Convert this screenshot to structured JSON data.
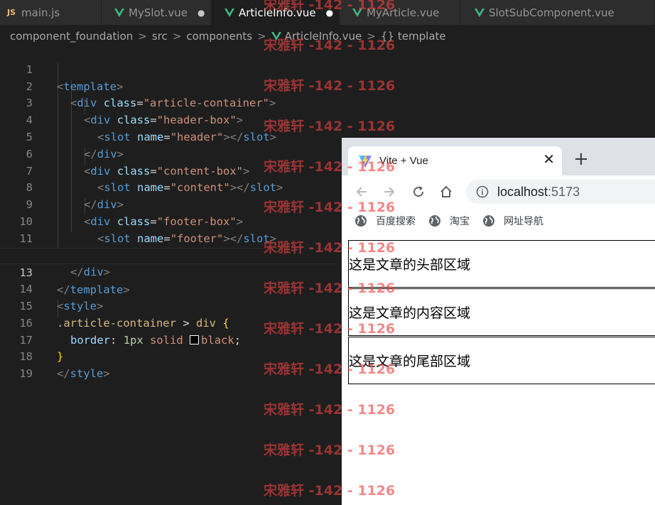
{
  "editor": {
    "tabs": [
      {
        "label": "main.js",
        "icon": "js-file-icon",
        "modified": false,
        "active": false
      },
      {
        "label": "MySlot.vue",
        "icon": "vue-file-icon",
        "modified": true,
        "active": false
      },
      {
        "label": "ArticleInfo.vue",
        "icon": "vue-file-icon",
        "modified": true,
        "active": true
      },
      {
        "label": "MyArticle.vue",
        "icon": "vue-file-icon",
        "modified": false,
        "active": false
      },
      {
        "label": "SlotSubComponent.vue",
        "icon": "vue-file-icon",
        "modified": false,
        "active": false
      }
    ],
    "js_icon_text": "JS",
    "modified_dot": "●",
    "breadcrumb": {
      "items": [
        "component_foundation",
        "src",
        "components",
        "ArticleInfo.vue",
        "template"
      ],
      "separator": ">",
      "symbol_icon": "{}"
    },
    "line_numbers": [
      "1",
      "2",
      "3",
      "4",
      "5",
      "6",
      "7",
      "8",
      "9",
      "10",
      "11",
      "12",
      "13",
      "14",
      "15",
      "16",
      "17",
      "18",
      "19"
    ],
    "current_line": "13",
    "code": {
      "l1": "template",
      "l2_tag": "div",
      "l2_attr": "class",
      "l2_val": "\"article-container\"",
      "l3_tag": "div",
      "l3_attr": "class",
      "l3_val": "\"header-box\"",
      "l4_tag": "slot",
      "l4_attr": "name",
      "l4_val": "\"header\"",
      "l4_close": "slot",
      "l5": "div",
      "l6_tag": "div",
      "l6_attr": "class",
      "l6_val": "\"content-box\"",
      "l7_tag": "slot",
      "l7_attr": "name",
      "l7_val": "\"content\"",
      "l7_close": "slot",
      "l8": "div",
      "l9_tag": "div",
      "l9_attr": "class",
      "l9_val": "\"footer-box\"",
      "l10_tag": "slot",
      "l10_attr": "name",
      "l10_val": "\"footer\"",
      "l10_close": "slot",
      "l11": "div",
      "l12": "div",
      "l13": "template",
      "l14": "style",
      "l15_sel": ".article-container",
      "l15_comb": ">",
      "l15_el": "div",
      "l15_brace": "{",
      "l16_prop": "border",
      "l16_num": "1px",
      "l16_kw": "solid",
      "l16_color": "black",
      "l17": "}",
      "l18": "style"
    }
  },
  "browser": {
    "tab_title": "Vite + Vue",
    "tab_close": "✕",
    "new_tab": "+",
    "url_host": "localhost",
    "url_port": ":5173",
    "bookmarks": [
      "百度搜索",
      "淘宝",
      "网址导航"
    ],
    "boxes": [
      "这是文章的头部区域",
      "这是文章的内容区域",
      "这是文章的尾部区域"
    ]
  },
  "watermark": {
    "text": "宋雅轩 -142 - 1126",
    "color": "#e84040"
  }
}
